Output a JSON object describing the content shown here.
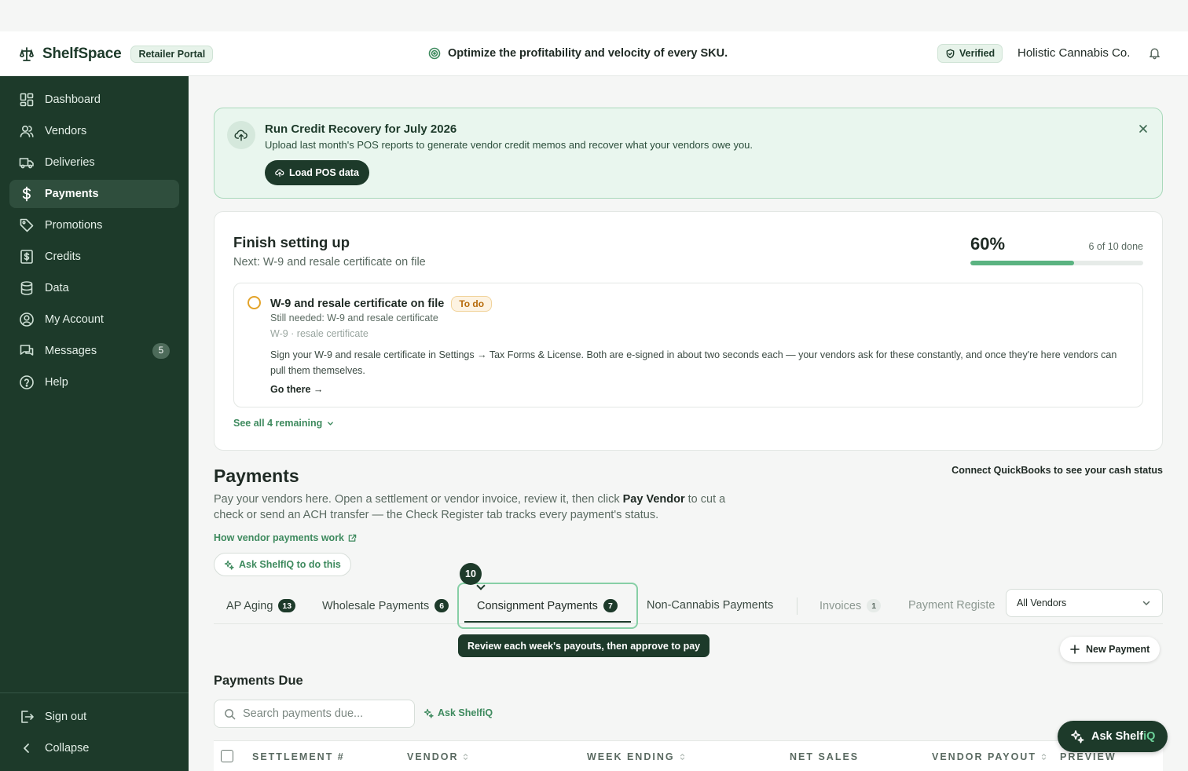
{
  "header": {
    "app_name": "ShelfSpace",
    "portal_badge": "Retailer Portal",
    "tagline": "Optimize the profitability and velocity of every SKU.",
    "verified_label": "Verified",
    "company": "Holistic Cannabis Co."
  },
  "sidebar": {
    "items": [
      {
        "label": "Dashboard",
        "icon": "dashboard-grid-icon"
      },
      {
        "label": "Vendors",
        "icon": "users-icon"
      },
      {
        "label": "Deliveries",
        "icon": "truck-icon"
      },
      {
        "label": "Payments",
        "icon": "dollar-icon",
        "active": true
      },
      {
        "label": "Promotions",
        "icon": "tag-icon"
      },
      {
        "label": "Credits",
        "icon": "receipt-icon"
      },
      {
        "label": "Data",
        "icon": "database-icon"
      },
      {
        "label": "My Account",
        "icon": "user-circle-icon"
      },
      {
        "label": "Messages",
        "icon": "chat-icon",
        "count": "5"
      },
      {
        "label": "Help",
        "icon": "help-icon"
      }
    ],
    "sign_out": "Sign out",
    "collapse": "Collapse"
  },
  "banner": {
    "title": "Run Credit Recovery for July 2026",
    "subtitle": "Upload last month's POS reports to generate vendor credit memos and recover what your vendors owe you.",
    "button": "Load POS data"
  },
  "setup": {
    "title": "Finish setting up",
    "next": "Next: W-9 and resale certificate on file",
    "percent": "60%",
    "progress_fraction": 0.6,
    "done_text": "6 of 10 done",
    "task": {
      "title": "W-9 and resale certificate on file",
      "status": "To do",
      "needed": "Still needed: W-9 and resale certificate",
      "tags": "W-9 · resale certificate",
      "description": "Sign your W-9 and resale certificate in Settings → Tax Forms & License. Both are e-signed in about two seconds each — your vendors ask for these constantly, and once they're here vendors can pull them themselves.",
      "link": "Go there →"
    },
    "see_all": "See all 4 remaining"
  },
  "payments": {
    "title": "Payments",
    "qb_link": "Connect QuickBooks to see your cash status",
    "desc_part1": "Pay your vendors here. Open a settlement or vendor invoice, review it, then click ",
    "desc_bold": "Pay Vendor",
    "desc_part2": " to cut a check or send an ACH transfer — the Check Register tab tracks every payment's status.",
    "how_link": "How vendor payments work",
    "ask_button": "Ask ShelfIQ to do this",
    "tabs": [
      {
        "label": "AP Aging",
        "count": "13"
      },
      {
        "label": "Wholesale Payments",
        "count": "6"
      },
      {
        "label": "Consignment Payments",
        "count": "7"
      },
      {
        "label": "Non-Cannabis Payments",
        "count": ""
      },
      {
        "label": "Invoices",
        "count": "1"
      },
      {
        "label": "Payment Registe",
        "count": ""
      }
    ],
    "step_number": "10",
    "tooltip": "Review each week's payouts, then approve to pay",
    "vendor_filter": "All Vendors",
    "new_payment": "New Payment",
    "due_title": "Payments Due",
    "search_placeholder": "Search payments due...",
    "ask_inline": "Ask ShelfiQ",
    "columns": [
      "SETTLEMENT #",
      "VENDOR",
      "WEEK ENDING",
      "NET SALES",
      "VENDOR PAYOUT",
      "PREVIEW"
    ]
  },
  "fab": {
    "label_main": "Ask Shelf",
    "label_accent": "iQ"
  }
}
